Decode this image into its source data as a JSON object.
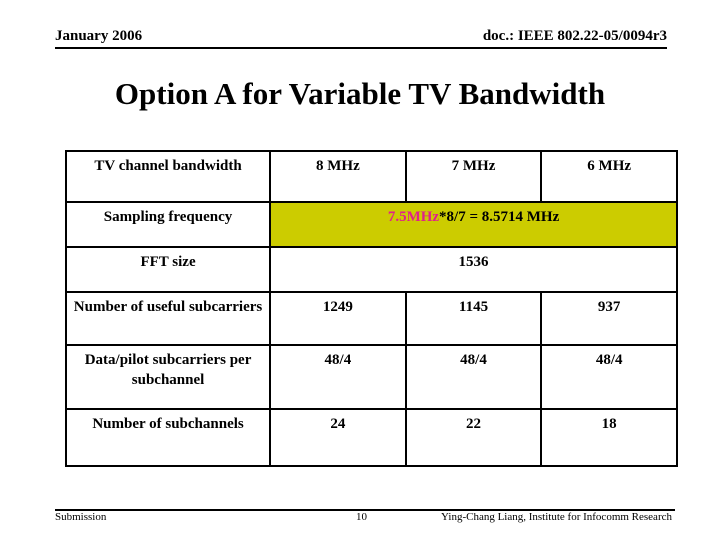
{
  "header": {
    "date": "January 2006",
    "doc_id": "doc.: IEEE 802.22-05/0094r3"
  },
  "title": "Option A for Variable TV Bandwidth",
  "table": {
    "columns": [
      "TV channel bandwidth",
      "8 MHz",
      "7 MHz",
      "6 MHz"
    ],
    "sampling_frequency": {
      "label": "Sampling frequency",
      "value_highlight": "7.5MHz",
      "value_rest": "*8/7 = 8.5714 MHz",
      "highlight_bg": "#CCCC00",
      "highlight_text_color": "#E0208C"
    },
    "fft_size": {
      "label": "FFT size",
      "value": "1536"
    },
    "rows": [
      {
        "label": "Number of useful subcarriers",
        "values": [
          "1249",
          "1145",
          "937"
        ]
      },
      {
        "label": "Data/pilot subcarriers per subchannel",
        "values": [
          "48/4",
          "48/4",
          "48/4"
        ]
      },
      {
        "label": "Number of subchannels",
        "values": [
          "24",
          "22",
          "18"
        ]
      }
    ]
  },
  "footer": {
    "left": "Submission",
    "page": "10",
    "author": "Ying-Chang Liang, Institute for Infocomm Research"
  }
}
